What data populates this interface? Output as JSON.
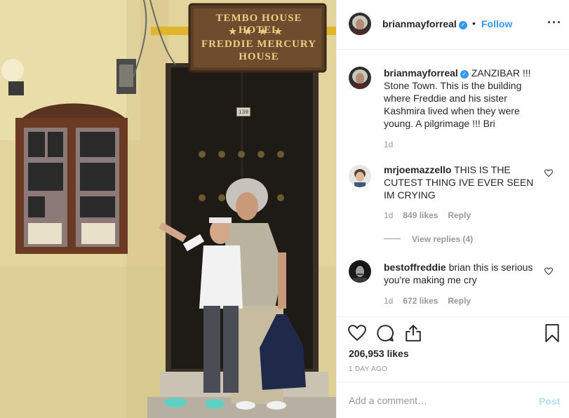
{
  "photo": {
    "sign_line1": "TEMBO HOUSE HOTEL",
    "sign_stars": "★★★★",
    "sign_line2": "FREDDIE MERCURY",
    "sign_line3": "HOUSE",
    "door_number": "139"
  },
  "header": {
    "username": "brianmayforreal",
    "separator": "•",
    "follow_label": "Follow",
    "more_label": "···"
  },
  "caption": {
    "username": "brianmayforreal",
    "text": "ZANZIBAR !!! Stone Town. This is the building where Freddie and his sister Kashmira lived when they were young. A pilgrimage !!! Bri",
    "time": "1d"
  },
  "comments": [
    {
      "username": "mrjoemazzello",
      "text": "THIS IS THE CUTEST THING IVE EVER SEEN IM CRYING",
      "time": "1d",
      "likes": "849 likes",
      "reply": "Reply"
    },
    {
      "username": "bestoffreddie",
      "text": "brian this is serious you're making me cry",
      "time": "1d",
      "likes": "672 likes",
      "reply": "Reply"
    }
  ],
  "view_replies": "View replies (4)",
  "actions": {
    "likes_count": "206,953 likes",
    "date": "1 DAY AGO"
  },
  "add_comment": {
    "placeholder": "Add a comment…",
    "post_label": "Post"
  },
  "colors": {
    "link_blue": "#3897f0",
    "muted_gray": "#999999",
    "post_disabled": "#b2dffc"
  }
}
